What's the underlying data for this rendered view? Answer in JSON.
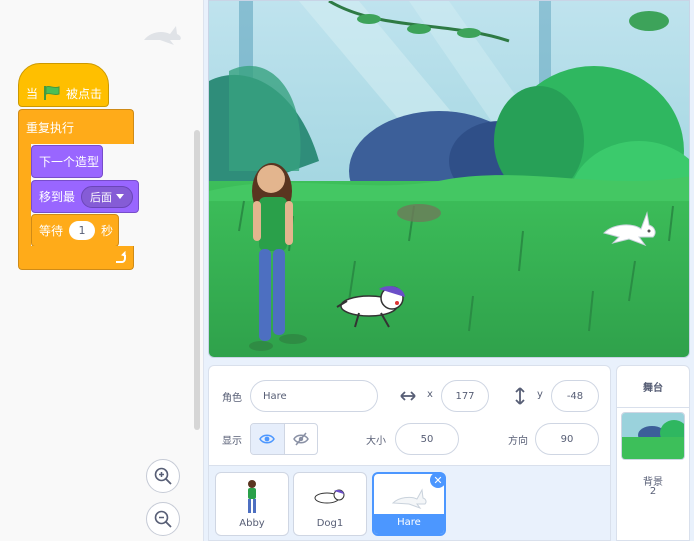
{
  "colors": {
    "events": "#ffbf00",
    "control": "#ffab19",
    "looks": "#9966ff",
    "accent": "#4c97ff",
    "flag": "#4cbf56"
  },
  "script": {
    "when_flag": {
      "prefix": "当",
      "suffix": "被点击"
    },
    "forever": {
      "label": "重复执行"
    },
    "next_costume": {
      "label": "下一个造型"
    },
    "go_to_layer": {
      "label": "移到最",
      "option": "后面"
    },
    "wait": {
      "prefix": "等待",
      "value": "1",
      "suffix": "秒"
    }
  },
  "zoom": {
    "zoom_in_icon": "zoom-in-icon",
    "zoom_out_icon": "zoom-out-icon"
  },
  "sprite_info": {
    "sprite_label": "角色",
    "sprite_name": "Hare",
    "x_label": "x",
    "x_value": "177",
    "y_label": "y",
    "y_value": "-48",
    "show_label": "显示",
    "size_label": "大小",
    "size_value": "50",
    "direction_label": "方向",
    "direction_value": "90"
  },
  "sprites": [
    {
      "name": "Abby"
    },
    {
      "name": "Dog1"
    },
    {
      "name": "Hare",
      "selected": true
    }
  ],
  "stage_panel": {
    "title": "舞台",
    "backdrop_label": "背景",
    "backdrop_count": "2"
  }
}
